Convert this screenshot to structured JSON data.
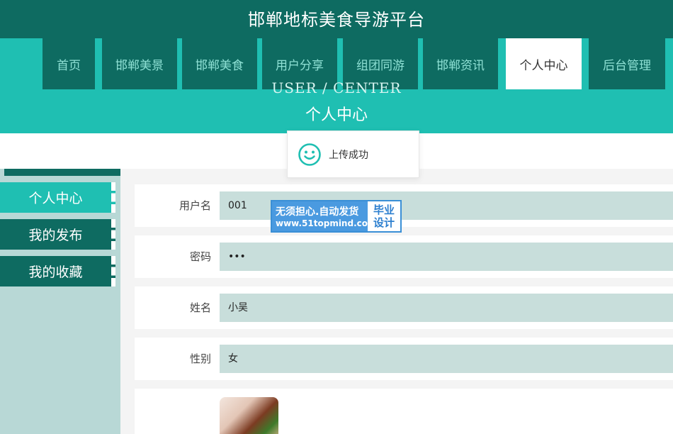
{
  "site": {
    "title": "邯郸地标美食导游平台"
  },
  "nav": {
    "items": [
      {
        "label": "首页"
      },
      {
        "label": "邯郸美景"
      },
      {
        "label": "邯郸美食"
      },
      {
        "label": "用户分享"
      },
      {
        "label": "组团同游"
      },
      {
        "label": "邯郸资讯"
      },
      {
        "label": "个人中心",
        "active": true
      },
      {
        "label": "后台管理"
      }
    ]
  },
  "banner": {
    "en": "USER / CENTER",
    "cn": "个人中心"
  },
  "toast": {
    "icon": "smile-icon",
    "message": "上传成功",
    "color": "#1fbfb2"
  },
  "sidebar": {
    "items": [
      {
        "label": "个人中心",
        "active": true
      },
      {
        "label": "我的发布"
      },
      {
        "label": "我的收藏"
      }
    ]
  },
  "form": {
    "username": {
      "label": "用户名",
      "value": "001"
    },
    "password": {
      "label": "密码",
      "value": "•••"
    },
    "name": {
      "label": "姓名",
      "value": "小吴"
    },
    "gender": {
      "label": "性别",
      "value": "女"
    },
    "avatar": {
      "image": "food-photo"
    }
  },
  "watermark": {
    "line1": "无须担心.自动发货",
    "line2": "www.51topmind.com",
    "badge_line1": "毕业",
    "badge_line2": "设计"
  },
  "colors": {
    "dark": "#0e6b61",
    "accent": "#1fbfb2",
    "input_bg": "#c8dedb"
  }
}
